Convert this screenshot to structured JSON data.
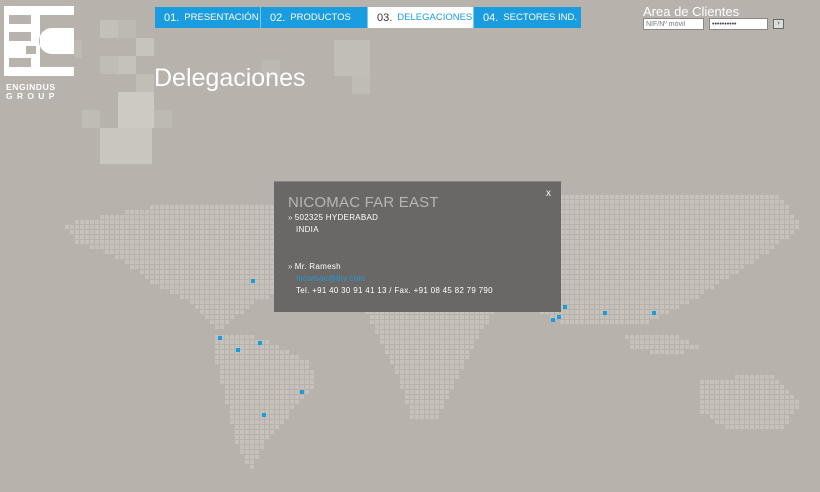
{
  "logo": {
    "line1": "ENGINDUS",
    "line2": "GROUP"
  },
  "nav": {
    "tabs": [
      {
        "num": "01.",
        "label": "PRESENTACIÓN"
      },
      {
        "num": "02.",
        "label": "PRODUCTOS"
      },
      {
        "num": "03.",
        "label": "DELEGACIONES"
      },
      {
        "num": "04.",
        "label": "SECTORES IND."
      }
    ],
    "active_index": 2
  },
  "client_area": {
    "title": "Area de Clientes",
    "user_placeholder": "NIF/Nº móvil",
    "password_value": "••••••••••",
    "submit_label": "›"
  },
  "page": {
    "title": "Delegaciones"
  },
  "popup": {
    "title": "NICOMAC FAR EAST",
    "close_label": "x",
    "address_line1": "502325 HYDERABAD",
    "address_line2": "INDIA",
    "contact_name": "Mr. Ramesh",
    "contact_email": "nicomac@lhy.com",
    "contact_phone": "Tel. +91 40 30 91 41 13 / Fax. +91 08 45 82 79 790"
  },
  "colors": {
    "background": "#b7b2ab",
    "accent_blue": "#1a9ce0",
    "popup_background": "#6a6866",
    "map_grid": "#c6c2bb"
  }
}
